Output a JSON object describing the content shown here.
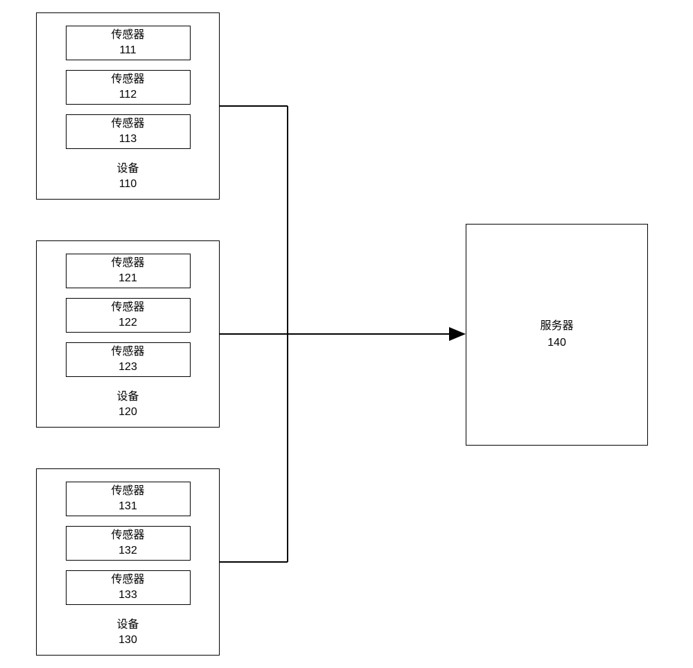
{
  "devices": [
    {
      "device_label": "设备",
      "device_num": "110",
      "sensors": [
        {
          "label": "传感器",
          "num": "111"
        },
        {
          "label": "传感器",
          "num": "112"
        },
        {
          "label": "传感器",
          "num": "113"
        }
      ]
    },
    {
      "device_label": "设备",
      "device_num": "120",
      "sensors": [
        {
          "label": "传感器",
          "num": "121"
        },
        {
          "label": "传感器",
          "num": "122"
        },
        {
          "label": "传感器",
          "num": "123"
        }
      ]
    },
    {
      "device_label": "设备",
      "device_num": "130",
      "sensors": [
        {
          "label": "传感器",
          "num": "131"
        },
        {
          "label": "传感器",
          "num": "132"
        },
        {
          "label": "传感器",
          "num": "133"
        }
      ]
    }
  ],
  "server": {
    "label": "服务器",
    "num": "140"
  }
}
